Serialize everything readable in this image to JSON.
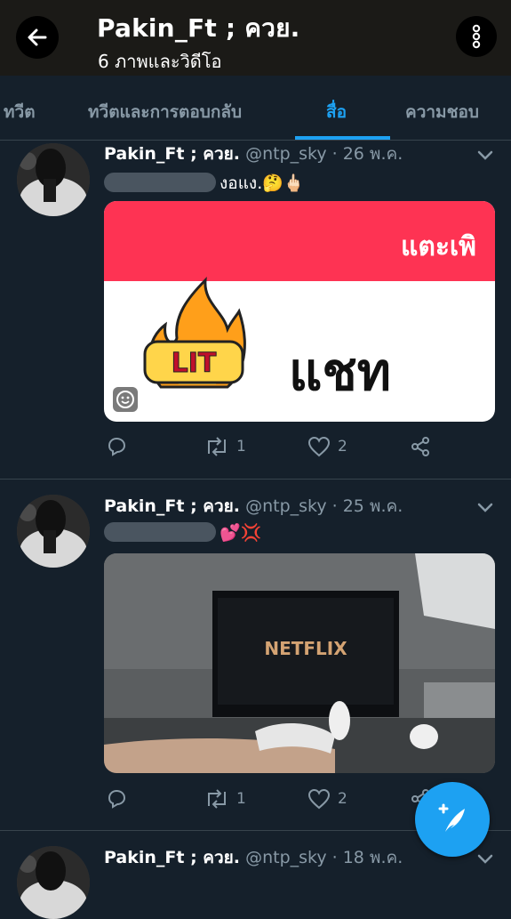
{
  "header": {
    "title": "Pakin_Ft ; ควย.",
    "subtitle": "6 ภาพและวิดีโอ"
  },
  "tabs": [
    {
      "label": "ทวีต"
    },
    {
      "label": "ทวีตและการตอบกลับ"
    },
    {
      "label": "สื่อ",
      "active": true
    },
    {
      "label": "ความชอบ"
    }
  ],
  "tweets": [
    {
      "name": "Pakin_Ft ; ควย.",
      "meta": "@ntp_sky · 26 พ.ค.",
      "text": "งอแง.🤔🖕🏻",
      "media_banner_text": "แตะเพิ",
      "media_label": "แชท",
      "media_sticker_text": "LIT",
      "retweets": "1",
      "likes": "2"
    },
    {
      "name": "Pakin_Ft ; ควย.",
      "meta": "@ntp_sky · 25 พ.ค.",
      "text": "💕💢",
      "media_logo_text": "NETFLIX",
      "retweets": "1",
      "likes": "2"
    },
    {
      "name": "Pakin_Ft ; ควย.",
      "meta": "@ntp_sky · 18 พ.ค."
    }
  ],
  "colors": {
    "background": "#15202b",
    "accent": "#1da1f2",
    "secondary_text": "#8899a6",
    "topbar": "#1b1a17"
  },
  "icons": [
    "back-arrow-icon",
    "more-vertical-icon",
    "chevron-down-icon",
    "reply-icon",
    "retweet-icon",
    "like-icon",
    "share-icon",
    "compose-icon"
  ]
}
